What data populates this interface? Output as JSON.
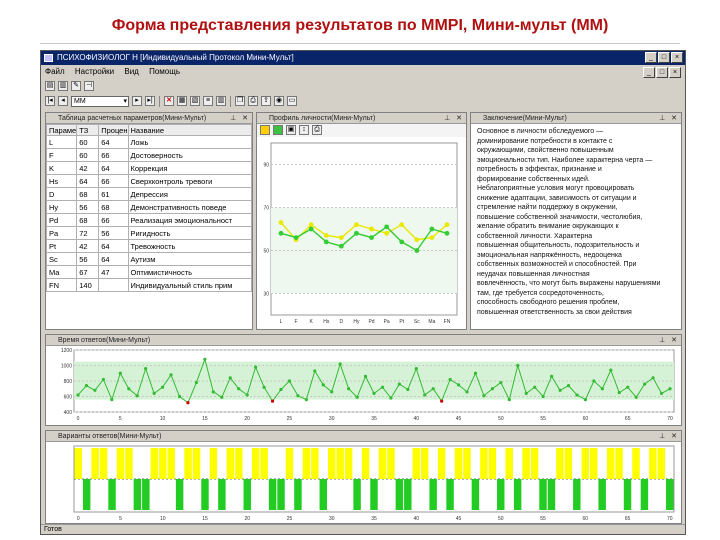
{
  "slide": {
    "title": "Форма представления результатов по MMPI, Мини-мульт (ММ)"
  },
  "window": {
    "title": "ПСИХОФИЗИОЛОГ Н  [Индивидуальный Протокол Мини-Мульт]",
    "min": "_",
    "max": "□",
    "close": "×"
  },
  "menu": {
    "items": [
      "Файл",
      "Настройки",
      "Вид",
      "Помощь"
    ]
  },
  "toolbar2": {
    "combo_value": "ММ"
  },
  "table_panel": {
    "title": "Таблица расчетных параметров(Мини-Мульт)",
    "headers": [
      "Параме",
      "ТЗ",
      "Процен",
      "Название"
    ],
    "rows": [
      [
        "L",
        "60",
        "64",
        "Ложь"
      ],
      [
        "F",
        "60",
        "66",
        "Достоверность"
      ],
      [
        "K",
        "42",
        "64",
        "Коррекция"
      ],
      [
        "Hs",
        "64",
        "66",
        "Сверхконтроль тревоги"
      ],
      [
        "D",
        "68",
        "61",
        "Депрессия"
      ],
      [
        "Hy",
        "56",
        "68",
        "Демонстративность поведе"
      ],
      [
        "Pd",
        "68",
        "66",
        "Реализация эмоциональност"
      ],
      [
        "Pa",
        "72",
        "56",
        "Ригидность"
      ],
      [
        "Pt",
        "42",
        "64",
        "Тревожность"
      ],
      [
        "Sc",
        "56",
        "64",
        "Аутизм"
      ],
      [
        "Ma",
        "67",
        "47",
        "Оптимистичность"
      ],
      [
        "FN",
        "140",
        "",
        "Индивидуальный стиль прим"
      ]
    ]
  },
  "profile_panel": {
    "title": "Профиль личности(Мини-Мульт)",
    "x_labels": [
      "L",
      "F",
      "K",
      "Hs",
      "D",
      "Hy",
      "Pd",
      "Pa",
      "Pt",
      "Sc",
      "Ma",
      "FN"
    ],
    "y_labels": [
      "90",
      "70",
      "50",
      "30"
    ],
    "series_green": [
      58,
      56,
      60,
      54,
      52,
      58,
      56,
      61,
      54,
      50,
      60,
      58
    ],
    "series_yellow": [
      63,
      55,
      62,
      57,
      56,
      62,
      60,
      58,
      62,
      55,
      56,
      62
    ]
  },
  "report_panel": {
    "title": "Заключение(Мини-Мульт)",
    "lines": [
      "Основное в личности обследуемого —",
      "доминирование потребности в контакте с",
      "окружающими, свойственно повышенным",
      "эмоциональности тип. Наиболее характерна черта —",
      "потребность в эффектах, признание и",
      "формирование собственных идей.",
      "Неблагоприятные условия могут провоцировать",
      "снижение адаптации, зависимость от ситуации и",
      "стремление найти поддержку в окружении,",
      "повышение собственной значимости, честолюбия,",
      "желание обратить внимание окружающих к",
      "собственной личности. Характерна",
      "повышенная общительность, подозрительность и",
      "эмоциональная напряжённость, недооценка",
      "собственных возможностей и способностей. При",
      "неудачах повышенная личностная",
      "вовлечённость, что могут быть выражены нарушениями",
      "там, где требуется сосредоточенность,",
      "способность свободного решения проблем,",
      "повышенная ответственность за свои действия"
    ]
  },
  "answers_panel": {
    "title": "Время ответов(Мини-Мульт)",
    "y_labels": [
      "1200",
      "1000",
      "800",
      "600",
      "400"
    ],
    "x_labels": [
      "0",
      "5",
      "10",
      "15",
      "20",
      "25",
      "30",
      "35",
      "40",
      "45",
      "50",
      "55",
      "60",
      "65",
      "70"
    ],
    "values": [
      620,
      740,
      680,
      820,
      560,
      900,
      700,
      610,
      960,
      640,
      720,
      880,
      600,
      520,
      780,
      1080,
      660,
      590,
      840,
      700,
      620,
      980,
      720,
      540,
      690,
      800,
      610,
      560,
      930,
      750,
      660,
      1020,
      700,
      590,
      860,
      640,
      720,
      580,
      760,
      690,
      960,
      620,
      700,
      540,
      820,
      750,
      660,
      900,
      610,
      700,
      780,
      560,
      1000,
      640,
      720,
      600,
      860,
      680,
      740,
      620,
      560,
      800,
      700,
      940,
      650,
      720,
      590,
      760,
      840,
      640,
      700
    ]
  },
  "bars_panel": {
    "title": "Варианты ответов(Мини-Мульт)",
    "x_labels": [
      "0",
      "5",
      "10",
      "15",
      "20",
      "25",
      "30",
      "35",
      "40",
      "45",
      "50",
      "55",
      "60",
      "65",
      "70"
    ],
    "answers": [
      1,
      0,
      1,
      1,
      0,
      1,
      1,
      0,
      0,
      1,
      1,
      1,
      0,
      1,
      1,
      0,
      1,
      0,
      1,
      1,
      0,
      1,
      1,
      0,
      0,
      1,
      0,
      1,
      1,
      0,
      1,
      1,
      1,
      0,
      1,
      0,
      1,
      1,
      0,
      0,
      1,
      1,
      0,
      1,
      0,
      1,
      1,
      0,
      1,
      1,
      0,
      1,
      0,
      1,
      1,
      0,
      0,
      1,
      1,
      0,
      1,
      1,
      0,
      1,
      1,
      0,
      1,
      0,
      1,
      1,
      0
    ],
    "colors": {
      "yes": "#ffff00",
      "no": "#22cc22"
    }
  },
  "status": {
    "text": "Готов"
  }
}
